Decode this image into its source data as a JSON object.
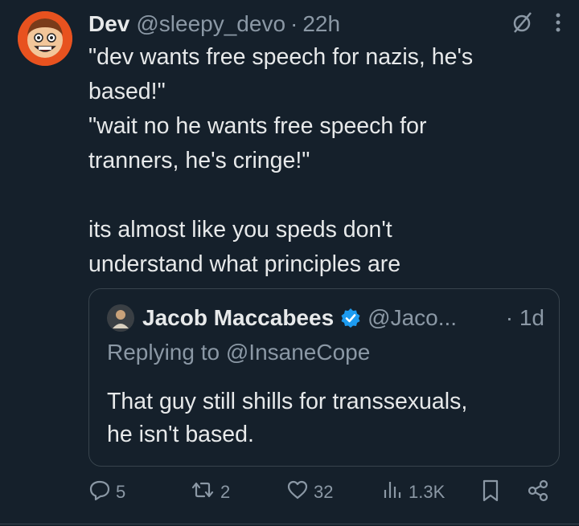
{
  "tweet": {
    "author_name": "Dev",
    "author_handle": "@sleepy_devo",
    "separator": "·",
    "time": "22h",
    "text": "\"dev wants free speech for nazis, he's\nbased!\"\n\"wait no he wants free speech for\ntranners, he's cringe!\"\n\nits almost like you speds don't\nunderstand what principles are",
    "icons": {
      "grok": "grok-slash-icon",
      "more": "more-vertical-icon"
    }
  },
  "quote": {
    "author_name": "Jacob Maccabees",
    "verified": true,
    "author_handle": "@Jaco...",
    "separator": "·",
    "time": "1d",
    "replying_to": "Replying to @InsaneCope",
    "text": "That guy still shills for transsexuals,\nhe isn't based."
  },
  "actions": {
    "replies": "5",
    "reposts": "2",
    "likes": "32",
    "views": "1.3K"
  },
  "colors": {
    "background": "#15202b",
    "text": "#e7e9ea",
    "muted": "#8b98a5",
    "border": "#38444d",
    "verified": "#1d9bf0",
    "avatar_ring": "#e8521f"
  }
}
